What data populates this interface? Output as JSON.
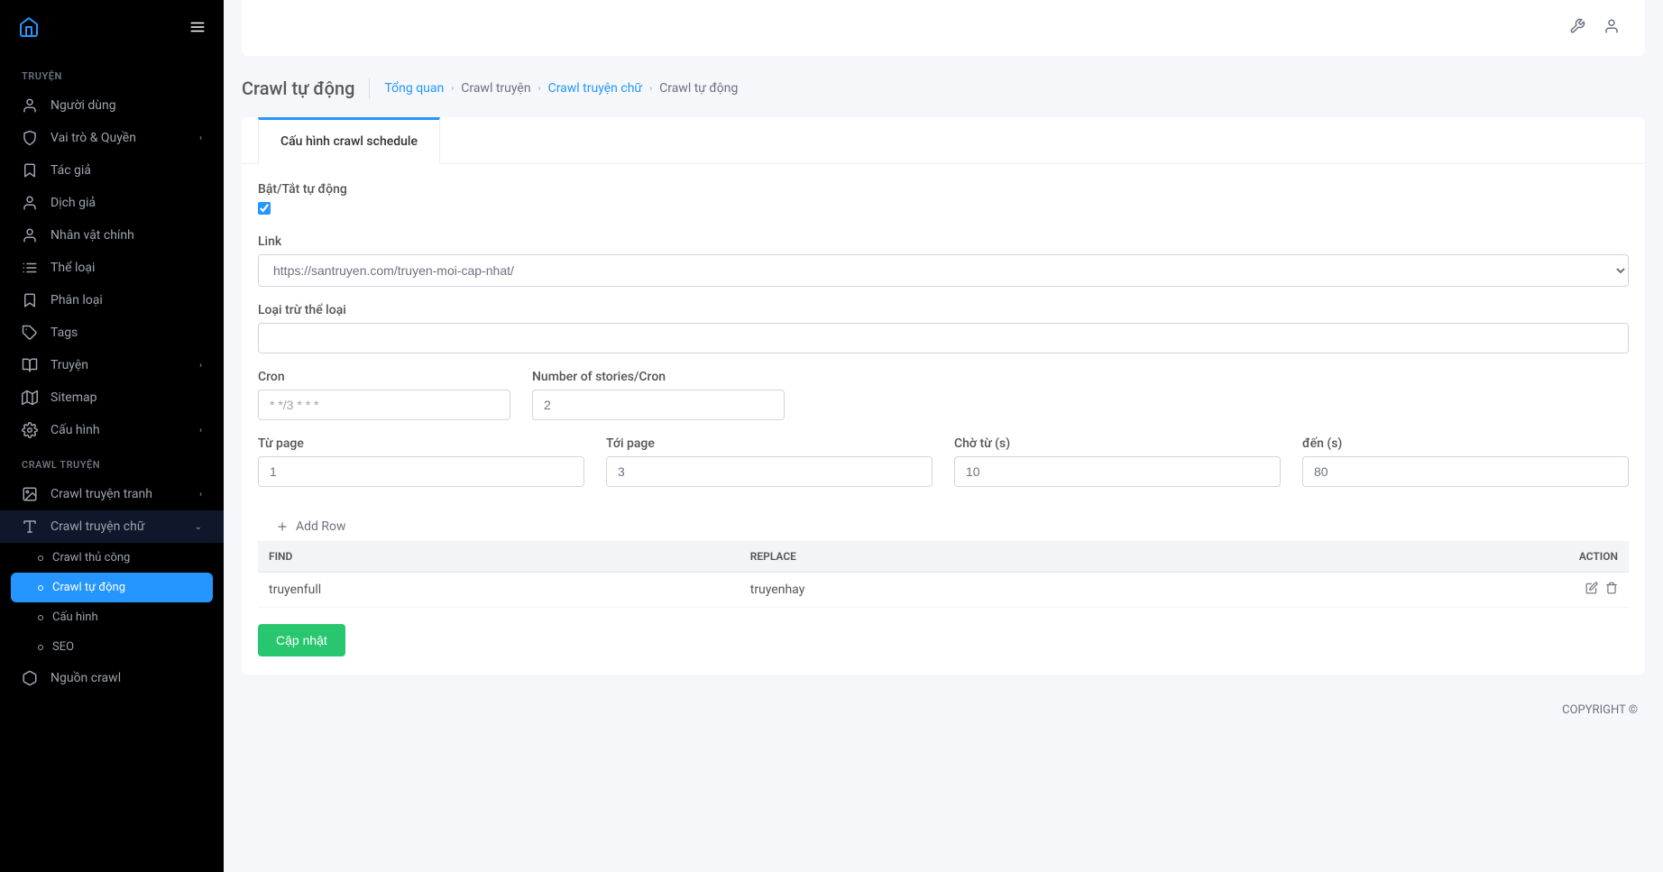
{
  "sidebar": {
    "section1_title": "TRUYỆN",
    "items1": [
      {
        "label": "Người dùng"
      },
      {
        "label": "Vai trò & Quyền",
        "chev": true
      },
      {
        "label": "Tác giả"
      },
      {
        "label": "Dịch giả"
      },
      {
        "label": "Nhân vật chính"
      },
      {
        "label": "Thể loại"
      },
      {
        "label": "Phân loại"
      },
      {
        "label": "Tags"
      },
      {
        "label": "Truyện",
        "chev": true
      },
      {
        "label": "Sitemap"
      },
      {
        "label": "Cấu hình",
        "chev": true
      }
    ],
    "section2_title": "CRAWL TRUYỆN",
    "items2": [
      {
        "label": "Crawl truyện tranh",
        "chev": true
      },
      {
        "label": "Crawl truyện chữ",
        "chev": true,
        "expanded": true
      }
    ],
    "subitems": [
      {
        "label": "Crawl thủ công"
      },
      {
        "label": "Crawl tự động",
        "active": true
      },
      {
        "label": "Cấu hình"
      },
      {
        "label": "SEO"
      }
    ],
    "items3": [
      {
        "label": "Nguồn crawl"
      }
    ]
  },
  "header": {
    "page_title": "Crawl tự động",
    "breadcrumb": [
      "Tổng quan",
      "Crawl truyện",
      "Crawl truyện chữ",
      "Crawl tự động"
    ]
  },
  "tabs": {
    "active": "Cấu hình crawl schedule"
  },
  "form": {
    "toggle_label": "Bật/Tắt tự động",
    "toggle_checked": true,
    "link_label": "Link",
    "link_value": "https://santruyen.com/truyen-moi-cap-nhat/",
    "exclude_label": "Loại trừ thể loại",
    "exclude_value": "",
    "cron_label": "Cron",
    "cron_placeholder": "* */3 * * *",
    "cron_value": "",
    "num_label": "Number of stories/Cron",
    "num_value": "2",
    "from_label": "Từ page",
    "from_value": "1",
    "to_label": "Tới page",
    "to_value": "3",
    "wait_from_label": "Chờ từ (s)",
    "wait_from_value": "10",
    "wait_to_label": "đến (s)",
    "wait_to_value": "80",
    "add_row": "Add Row",
    "table": {
      "headers": [
        "FIND",
        "REPLACE",
        "ACTION"
      ],
      "rows": [
        {
          "find": "truyenfull",
          "replace": "truyenhay"
        }
      ]
    },
    "submit": "Cập nhật"
  },
  "footer": {
    "copyright": "COPYRIGHT ©"
  }
}
